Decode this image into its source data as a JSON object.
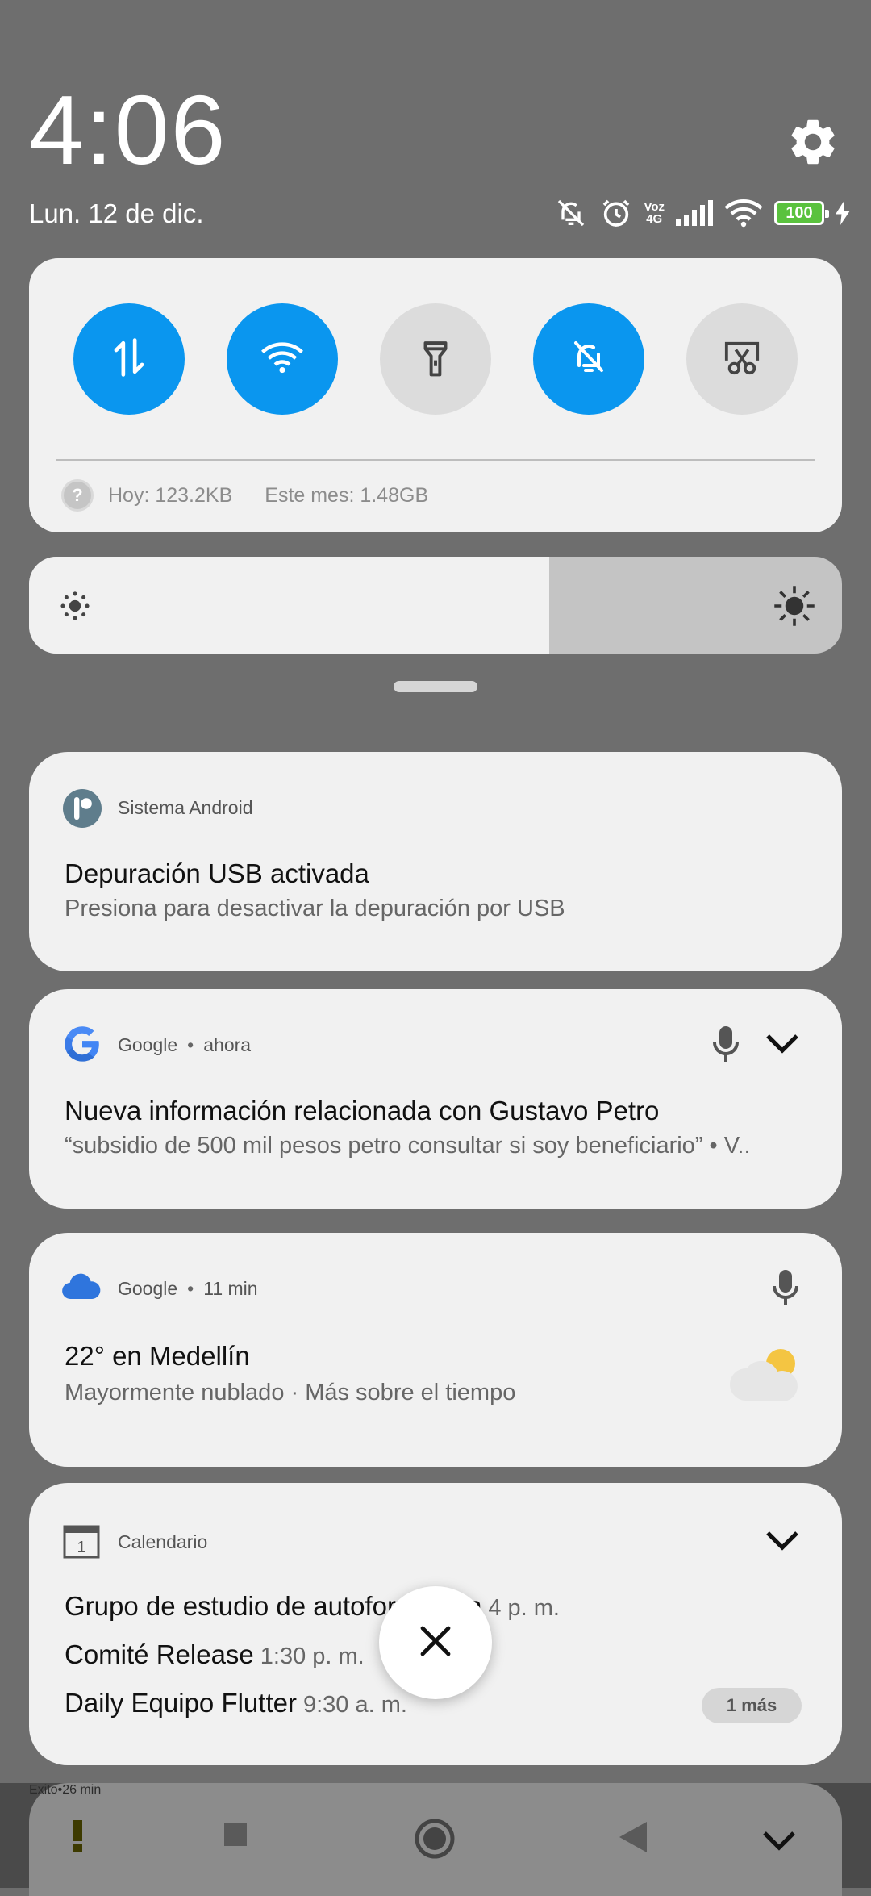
{
  "header": {
    "time": "4:06",
    "date": "Lun. 12 de dic.",
    "network_label": "Voz\n4G",
    "battery": "100"
  },
  "quick_settings": {
    "tiles": [
      {
        "name": "mobile-data",
        "active": true
      },
      {
        "name": "wifi",
        "active": true
      },
      {
        "name": "flashlight",
        "active": false
      },
      {
        "name": "mute",
        "active": true
      },
      {
        "name": "screenshot",
        "active": false
      }
    ],
    "usage_today": "Hoy: 123.2KB",
    "usage_month": "Este mes: 1.48GB",
    "brightness": 0.64
  },
  "notifications": [
    {
      "app": "Sistema Android",
      "title": "Depuración USB activada",
      "text": "Presiona para desactivar la depuración por USB"
    },
    {
      "app": "Google",
      "time": "ahora",
      "title": "Nueva información relacionada con Gustavo Petro",
      "text": "“subsidio de 500 mil pesos petro consultar si soy beneficiario” • V.."
    },
    {
      "app": "Google",
      "time": "11 min",
      "title": "22° en Medellín",
      "text": "Mayormente nublado · Más sobre el tiempo"
    },
    {
      "app": "Calendario",
      "calendar_day": "1",
      "events": [
        {
          "title": "Grupo de estudio de autoformacion",
          "time": "4 p. m."
        },
        {
          "title": "Comité Release",
          "time": "1:30 p. m."
        },
        {
          "title": "Daily Equipo Flutter",
          "time": "9:30 a. m."
        }
      ],
      "more": "1 más"
    },
    {
      "app": "Exito",
      "time": "26 min"
    }
  ],
  "colors": {
    "accent": "#0a96ef",
    "battery": "#5ac23e",
    "background": "#6e6e6e"
  }
}
